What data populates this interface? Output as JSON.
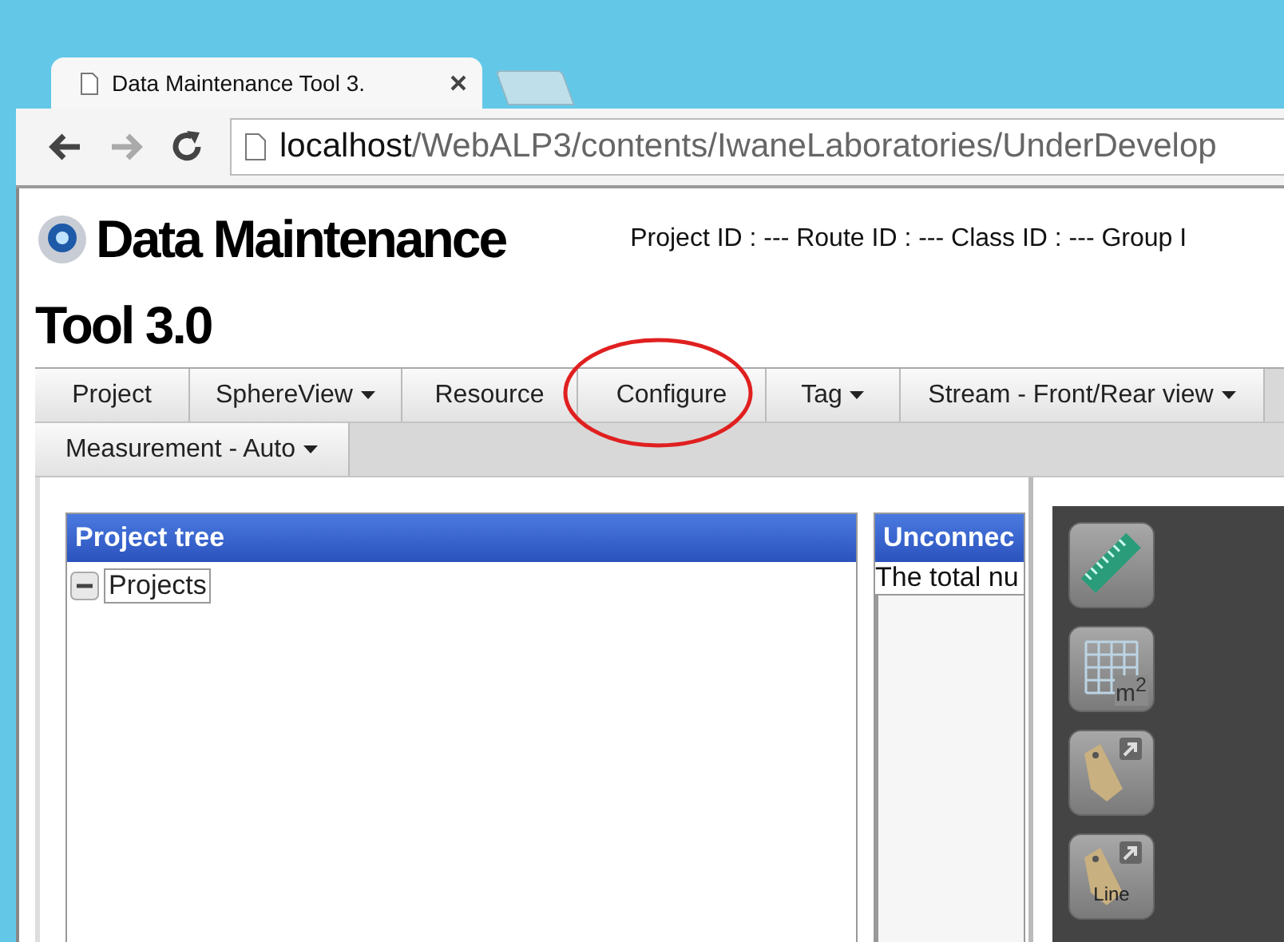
{
  "browser": {
    "tab_title": "Data Maintenance Tool 3.",
    "url_host": "localhost",
    "url_path": "/WebALP3/contents/IwaneLaboratories/UnderDevelop"
  },
  "app": {
    "title_line_1": "Data Maintenance",
    "title_line_2": "Tool 3.0",
    "ids": "Project ID : --- Route ID : --- Class ID : --- Group I"
  },
  "menu_rows": [
    [
      {
        "label": "Project",
        "dropdown": false,
        "circled": false
      },
      {
        "label": "SphereView",
        "dropdown": true,
        "circled": false
      },
      {
        "label": "Resource",
        "dropdown": false,
        "circled": false
      },
      {
        "label": "Configure",
        "dropdown": false,
        "circled": true
      },
      {
        "label": "Tag",
        "dropdown": true,
        "circled": false
      },
      {
        "label": "Stream - Front/Rear view",
        "dropdown": true,
        "circled": false
      }
    ],
    [
      {
        "label": "Measurement - Auto",
        "dropdown": true,
        "circled": false
      }
    ]
  ],
  "project_tree": {
    "title": "Project tree",
    "items": [
      {
        "label": "Projects",
        "expanded": true
      }
    ]
  },
  "unconnected_panel": {
    "title": "Unconnec",
    "text": "The total nu"
  },
  "tools": [
    {
      "kind": "ruler"
    },
    {
      "kind": "area",
      "label": "m$^{2}$"
    },
    {
      "kind": "tag"
    },
    {
      "kind": "tag",
      "label": "Line"
    }
  ]
}
